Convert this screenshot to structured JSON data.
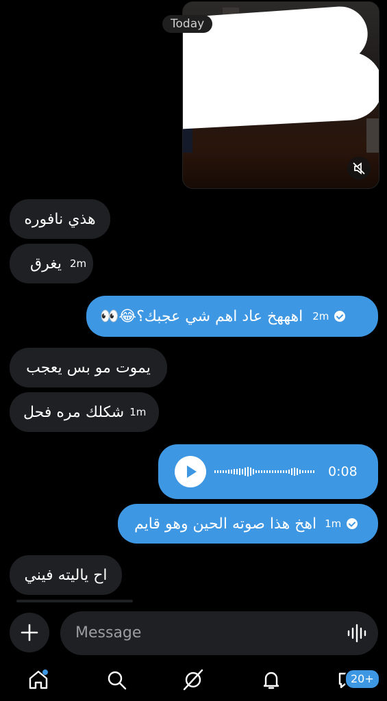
{
  "date_separator": "Today",
  "messages": [
    {
      "text": "هذي نافوره",
      "time": ""
    },
    {
      "text": "يغرق",
      "time": "2m"
    },
    {
      "text": "اهههخ عاد اهم شي عجبك؟😂👀",
      "time": "2m"
    },
    {
      "text": "يموت مو بس يعجب",
      "time": ""
    },
    {
      "text": "شكلك مره فحل",
      "time": "1m"
    },
    {
      "text": "اهخ هذا صوته الحين وهو قايم",
      "time": "1m"
    },
    {
      "text": "اح ياليته فيني",
      "time": ""
    }
  ],
  "voice_note": {
    "duration": "0:08"
  },
  "composer": {
    "placeholder": "Message"
  },
  "nav": {
    "messages_badge": "20+"
  },
  "colors": {
    "accent": "#3e97e2",
    "incoming_bubble": "#1e2023",
    "background": "#000000"
  }
}
